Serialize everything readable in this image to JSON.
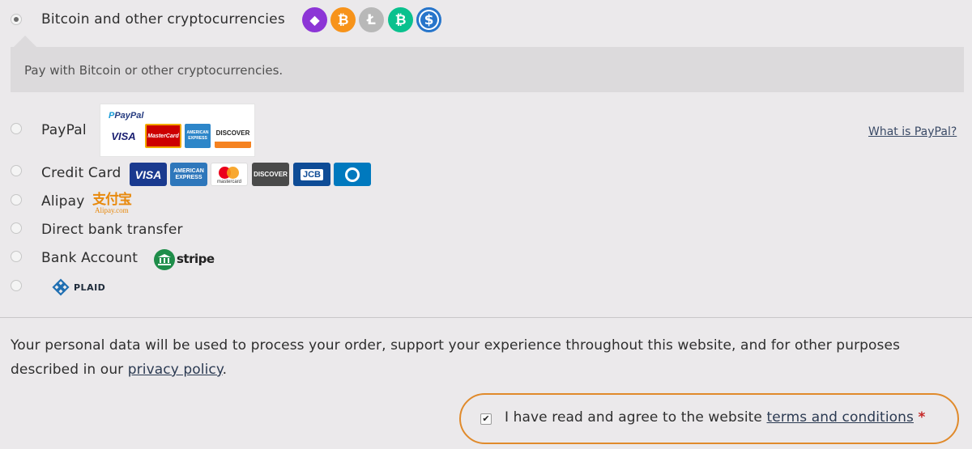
{
  "crypto": {
    "label": "Bitcoin and other cryptocurrencies",
    "description": "Pay with Bitcoin or other cryptocurrencies.",
    "coins": [
      {
        "name": "ethereum-icon",
        "symbol": "◆",
        "color": "#8c35d6"
      },
      {
        "name": "bitcoin-icon",
        "symbol": "₿",
        "color": "#f7931a"
      },
      {
        "name": "litecoin-icon",
        "symbol": "Ł",
        "color": "#b8b8b8"
      },
      {
        "name": "bitcoin-cash-icon",
        "symbol": "₿",
        "color": "#0ac18e"
      },
      {
        "name": "usd-coin-icon",
        "symbol": "$",
        "color": "#2775ca"
      }
    ]
  },
  "paypal": {
    "label": "PayPal",
    "logo_text": "PayPal",
    "cards": [
      "VISA",
      "MasterCard",
      "AMERICAN EXPRESS",
      "DISCOVER"
    ],
    "link": "What is PayPal?"
  },
  "credit_card": {
    "label": "Credit Card",
    "cards": [
      "VISA",
      "AMERICAN EXPRESS",
      "mastercard",
      "DISCOVER",
      "JCB",
      "Diners Club"
    ]
  },
  "alipay": {
    "label": "Alipay",
    "logo_cn": "支付宝",
    "logo_en": "Alipay.com"
  },
  "bank_transfer": {
    "label": "Direct bank transfer"
  },
  "bank_account": {
    "label": "Bank Account",
    "logo_text": "stripe"
  },
  "plaid": {
    "logo_text": "PLAID"
  },
  "privacy": {
    "text_before": "Your personal data will be used to process your order, support your experience throughout this website, and for other purposes described in our ",
    "link": "privacy policy",
    "text_after": "."
  },
  "terms": {
    "text_before": "I have read and agree to the website ",
    "link": "terms and conditions",
    "required_mark": "*",
    "checkmark": "✔"
  },
  "colors": {
    "accent_orange": "#e08a2b",
    "background": "#ebe9eb",
    "description_box": "#dcdadc"
  }
}
